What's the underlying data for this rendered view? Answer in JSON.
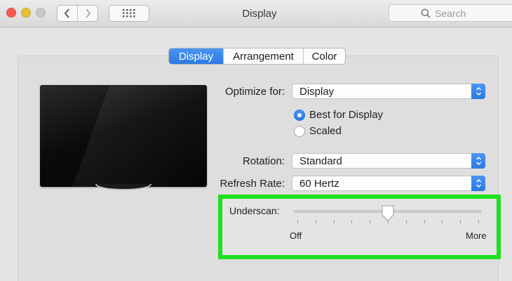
{
  "window": {
    "title": "Display",
    "search_placeholder": "Search"
  },
  "tabs": [
    {
      "label": "Display",
      "active": true
    },
    {
      "label": "Arrangement",
      "active": false
    },
    {
      "label": "Color",
      "active": false
    }
  ],
  "form": {
    "optimize_label": "Optimize for:",
    "optimize_value": "Display",
    "radio_best": "Best for Display",
    "radio_scaled": "Scaled",
    "radio_selected": "Best for Display",
    "rotation_label": "Rotation:",
    "rotation_value": "Standard",
    "refresh_label": "Refresh Rate:",
    "refresh_value": "60 Hertz"
  },
  "underscan": {
    "label": "Underscan:",
    "min_label": "Off",
    "max_label": "More",
    "value_fraction": 0.5,
    "tick_count": 11
  },
  "colors": {
    "accent": "#2c7ae3",
    "highlight": "#1fe01f"
  },
  "icons": {
    "back": "chevron-left-icon",
    "forward": "chevron-right-icon",
    "grid": "grid-icon",
    "search": "search-icon",
    "popup_arrows": "updown-chevron-icon"
  }
}
